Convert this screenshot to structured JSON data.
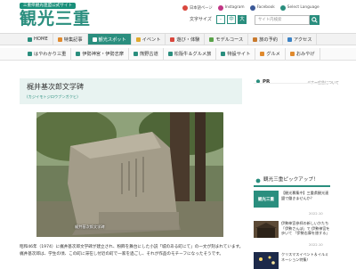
{
  "header": {
    "tagline": "三重県観光連盟公式サイト",
    "logo": "観光三重",
    "sns": [
      {
        "label": "日本語ページ",
        "color": "#d9473d"
      },
      {
        "label": "Instagram",
        "color": "#c13584"
      },
      {
        "label": "Facebook",
        "color": "#3b5998"
      },
      {
        "label": "Select Language",
        "color": "#2a8e7e"
      }
    ],
    "font_size_label": "文字サイズ",
    "font_sizes": [
      "-",
      "中",
      "大"
    ],
    "search_placeholder": "サイト内検索"
  },
  "nav_primary": [
    {
      "label": "HOME",
      "icon": "home-icon",
      "active": false
    },
    {
      "label": "特集記事",
      "icon": "feature-icon",
      "active": false
    },
    {
      "label": "観光スポット",
      "icon": "spot-icon",
      "active": true
    },
    {
      "label": "イベント",
      "icon": "event-icon",
      "active": false
    },
    {
      "label": "遊び・体験",
      "icon": "experience-icon",
      "active": false
    },
    {
      "label": "モデルコース",
      "icon": "course-icon",
      "active": false
    },
    {
      "label": "旅の予約",
      "icon": "reservation-icon",
      "active": false
    },
    {
      "label": "アクセス",
      "icon": "access-icon",
      "active": false
    }
  ],
  "nav_secondary": [
    {
      "label": "はやわかり三重"
    },
    {
      "label": "伊勢神宮・伊勢志摩"
    },
    {
      "label": "熊野古道"
    },
    {
      "label": "松阪牛＆グルメ旅"
    },
    {
      "label": "特設サイト"
    },
    {
      "label": "グルメ"
    },
    {
      "label": "おみやげ"
    }
  ],
  "article": {
    "title": "梶井基次郎文学碑",
    "subtitle": "(カジイモトジロウブンガクヒ)",
    "photo_caption": "梶井基次郎文学碑",
    "body": "昭和46年（1974）に梶井基次郎文学碑が建立され、粉飾を舞台にした小説「城のある町にて」の一文が刻まれています。梶井基次郎は、学生の頃、この町に滞在し付近の町で一家を過ごし、それが作品のモチーフになったそうです。"
  },
  "sidebar": {
    "pr_label": "PR",
    "pr_link": "バナー広告について",
    "pickup_title": "観光三重ピックアップ！",
    "pickups": [
      {
        "text": "【観光募集中】三重県観光連盟で働きませんか？",
        "date": "2022.10"
      },
      {
        "text": "伊勢神宮参拝の新しいかたち「伊勢さんぽ」で 伊勢神宮を歩いて 「伊勢志摩を旅する」",
        "date": "2022.10"
      },
      {
        "text": "クリスマスイベント＆イルミネーション特集！",
        "date": ""
      }
    ]
  }
}
